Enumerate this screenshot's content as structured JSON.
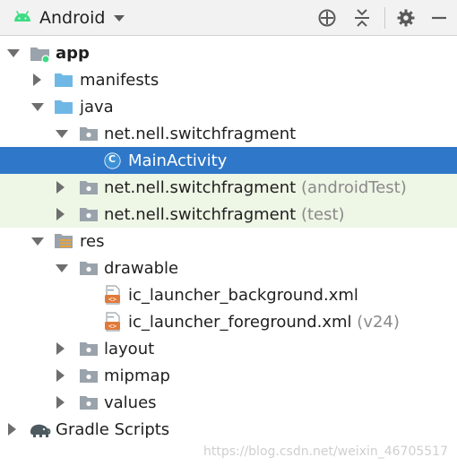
{
  "toolbar": {
    "view_label": "Android",
    "icons": [
      "android-icon",
      "dropdown-caret-icon",
      "crosshair-icon",
      "collapse-icon",
      "gear-icon",
      "minimize-icon"
    ]
  },
  "tree": {
    "app": {
      "label": "app"
    },
    "manifests": {
      "label": "manifests"
    },
    "java": {
      "label": "java"
    },
    "pkg_main": {
      "label": "net.nell.switchfragment"
    },
    "main_activity": {
      "label": "MainActivity",
      "badge": "C"
    },
    "pkg_android_test": {
      "label": "net.nell.switchfragment",
      "suffix": "(androidTest)"
    },
    "pkg_test": {
      "label": "net.nell.switchfragment",
      "suffix": "(test)"
    },
    "res": {
      "label": "res"
    },
    "drawable": {
      "label": "drawable"
    },
    "ic_bg": {
      "label": "ic_launcher_background.xml"
    },
    "ic_fg": {
      "label": "ic_launcher_foreground.xml",
      "suffix": "(v24)"
    },
    "layout": {
      "label": "layout"
    },
    "mipmap": {
      "label": "mipmap"
    },
    "values": {
      "label": "values"
    },
    "gradle": {
      "label": "Gradle Scripts"
    }
  },
  "colors": {
    "selection": "#2f77c8",
    "test_package_bg": "#eef6e6",
    "folder_blue": "#6fb8e6",
    "package_grey": "#9aa3ab",
    "android_green": "#3ddc84"
  },
  "watermark": "https://blog.csdn.net/weixin_46705517"
}
